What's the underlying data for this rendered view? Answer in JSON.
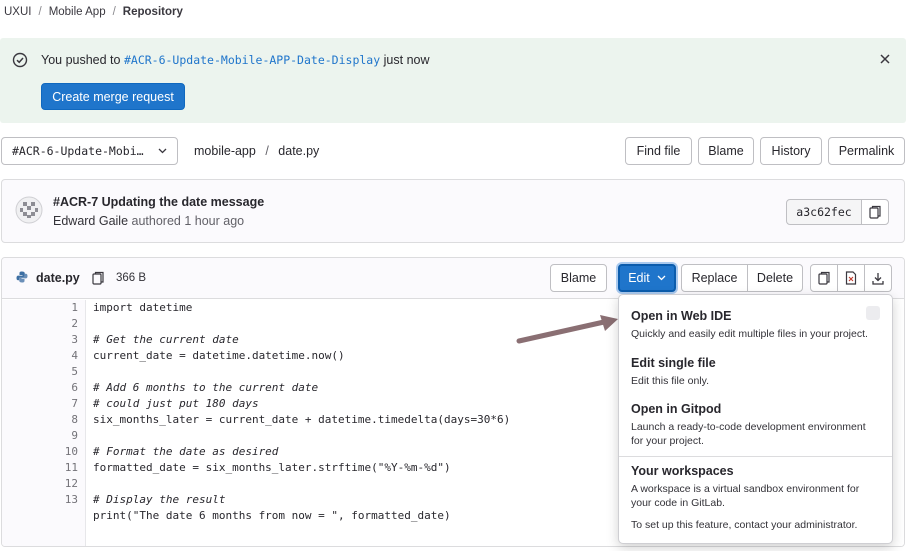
{
  "breadcrumb": {
    "items": [
      "UXUI",
      "Mobile App",
      "Repository"
    ]
  },
  "alert": {
    "message_prefix": "You pushed to",
    "branch": "#ACR-6-Update-Mobile-APP-Date-Display",
    "message_suffix": "just now",
    "button_label": "Create merge request"
  },
  "file_nav": {
    "branch_select": "#ACR-6-Update-Mobi…",
    "path_dir": "mobile-app",
    "path_sep": "/",
    "path_file": "date.py",
    "buttons": {
      "find_file": "Find file",
      "blame": "Blame",
      "history": "History",
      "permalink": "Permalink"
    }
  },
  "commit": {
    "title": "#ACR-7 Updating the date message",
    "author": "Edward Gaile",
    "meta_suffix": "authored 1 hour ago",
    "sha": "a3c62fec"
  },
  "file": {
    "name": "date.py",
    "size": "366 B",
    "buttons": {
      "blame": "Blame",
      "edit": "Edit",
      "replace": "Replace",
      "delete": "Delete"
    }
  },
  "code_lines": [
    {
      "num": "1",
      "text": "import datetime"
    },
    {
      "num": "2",
      "text": ""
    },
    {
      "num": "3",
      "text": "# Get the current date"
    },
    {
      "num": "4",
      "text": "current_date = datetime.datetime.now()"
    },
    {
      "num": "5",
      "text": ""
    },
    {
      "num": "6",
      "text": "# Add 6 months to the current date"
    },
    {
      "num": "7",
      "text": "# could just put 180 days"
    },
    {
      "num": "8",
      "text": "six_months_later = current_date + datetime.timedelta(days=30*6)"
    },
    {
      "num": "9",
      "text": ""
    },
    {
      "num": "10",
      "text": "# Format the date as desired"
    },
    {
      "num": "11",
      "text": "formatted_date = six_months_later.strftime(\"%Y-%m-%d\")"
    },
    {
      "num": "12",
      "text": ""
    },
    {
      "num": "13",
      "text": "# Display the result"
    },
    {
      "num": "",
      "text": "print(\"The date 6 months from now = \", formatted_date)"
    }
  ],
  "edit_menu": {
    "web_ide": {
      "title": "Open in Web IDE",
      "desc": "Quickly and easily edit multiple files in your project."
    },
    "single_file": {
      "title": "Edit single file",
      "desc": "Edit this file only."
    },
    "gitpod": {
      "title": "Open in Gitpod",
      "desc_1": "Launch a ready-to-code development environment",
      "desc_2": "for your project."
    },
    "workspaces": {
      "title": "Your workspaces",
      "desc_1": "A workspace is a virtual sandbox environment for",
      "desc_2": "your code in GitLab.",
      "note": "To set up this feature, contact your administrator."
    }
  },
  "colors": {
    "alert_bg": "#ecf4ee",
    "primary": "#1f75cb",
    "arrow": "#8a6f73"
  },
  "icons": [
    "check-circle-icon",
    "close-icon",
    "chevron-down-icon",
    "avatar",
    "copy-icon",
    "python-file-icon",
    "download-icon",
    "file-raw-icon",
    "arrow-annotation"
  ]
}
